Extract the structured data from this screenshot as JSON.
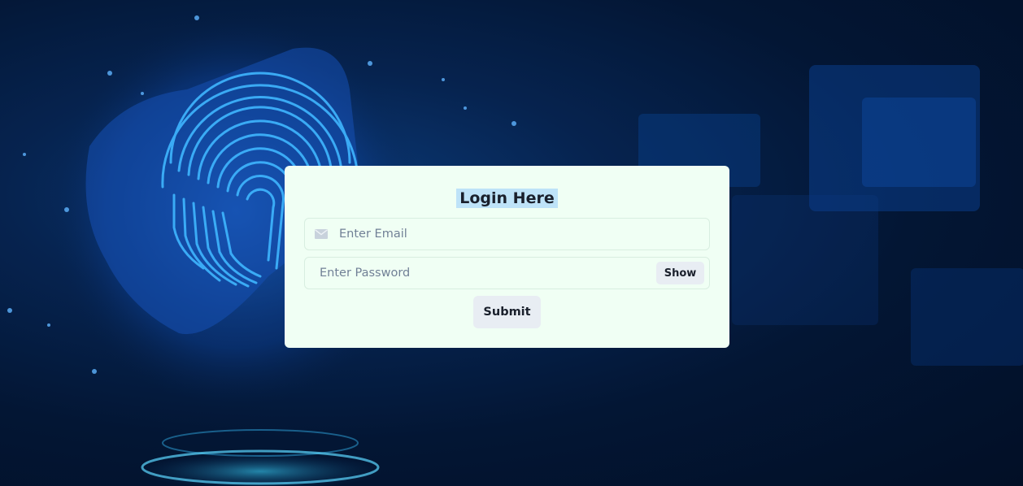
{
  "login": {
    "title": "Login Here",
    "email_placeholder": "Enter Email",
    "password_placeholder": "Enter Password",
    "show_label": "Show",
    "submit_label": "Submit"
  },
  "icons": {
    "email": "mail-icon",
    "background": "fingerprint-globe-image"
  },
  "colors": {
    "card_background": "#f0fff4",
    "title_highlight": "#bee3f8",
    "button_background": "#e8edf3",
    "page_background": "#031634"
  }
}
